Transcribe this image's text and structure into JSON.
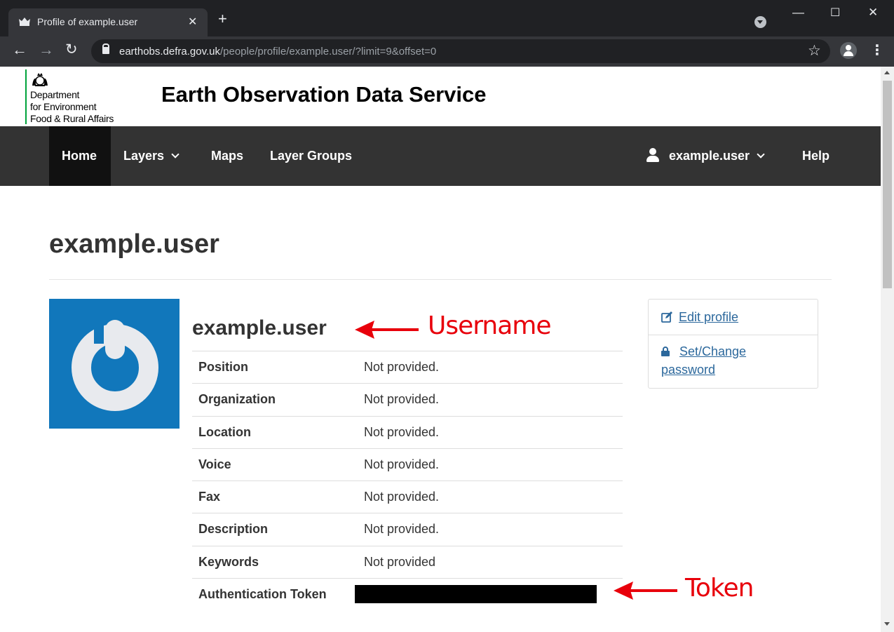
{
  "browser": {
    "tab_title": "Profile of example.user",
    "url_host": "earthobs.defra.gov.uk",
    "url_path": "/people/profile/example.user/?limit=9&offset=0"
  },
  "header": {
    "logo_lines": [
      "Department",
      "for Environment",
      "Food & Rural Affairs"
    ],
    "site_title": "Earth Observation Data Service"
  },
  "nav": {
    "items": [
      {
        "label": "Home",
        "active": true,
        "dropdown": false
      },
      {
        "label": "Layers",
        "active": false,
        "dropdown": true
      },
      {
        "label": "Maps",
        "active": false,
        "dropdown": false
      },
      {
        "label": "Layer Groups",
        "active": false,
        "dropdown": false
      }
    ],
    "user": {
      "label": "example.user",
      "icon": "user-icon",
      "dropdown": true
    },
    "help_label": "Help"
  },
  "page": {
    "heading": "example.user",
    "profile_name": "example.user",
    "fields": [
      {
        "label": "Position",
        "value": "Not provided."
      },
      {
        "label": "Organization",
        "value": "Not provided."
      },
      {
        "label": "Location",
        "value": "Not provided."
      },
      {
        "label": "Voice",
        "value": "Not provided."
      },
      {
        "label": "Fax",
        "value": "Not provided."
      },
      {
        "label": "Description",
        "value": "Not provided."
      },
      {
        "label": "Keywords",
        "value": "Not provided"
      },
      {
        "label": "Authentication Token",
        "value": ""
      }
    ],
    "actions": {
      "edit_profile": "Edit profile",
      "set_password_line1": "Set/Change",
      "set_password_line2": "password"
    }
  },
  "annotations": {
    "username": "Username",
    "token": "Token",
    "color": "#e8000b"
  },
  "colors": {
    "navbar": "#333333",
    "nav_active": "#111111",
    "avatar_bg": "#1177bb",
    "link": "#2c689c",
    "defra_green": "#00a33b"
  }
}
